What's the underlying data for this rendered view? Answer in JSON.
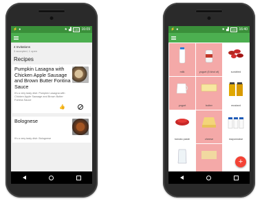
{
  "status": {
    "left_time": "16:09",
    "right_time": "16:40",
    "battery": "100"
  },
  "left_app": {
    "invitations_title": "4 Invitations",
    "invitations_sub": "3 accepted, 1 open",
    "section_title": "Recipes",
    "cards": [
      {
        "title": "Pumpkin Lasagna with Chicken Apple Sausage and Brown Butter Fontina Sauce",
        "desc": "It's a very tasty dish: Pumpkin Lasagna with Chicken Apple Sausage and Brown Butter Fontina Sauce"
      },
      {
        "title": "Bolognese",
        "desc": "It's a very tasty dish: Bolognese"
      }
    ]
  },
  "right_app": {
    "tiles": [
      {
        "label": "milk"
      },
      {
        "label": "yogurt (5 kind of)"
      },
      {
        "label": "sundried"
      },
      {
        "label": "yogurt"
      },
      {
        "label": "butter"
      },
      {
        "label": "mustard"
      },
      {
        "label": "tomato paste"
      },
      {
        "label": "cheese"
      },
      {
        "label": "mayonnaise"
      },
      {
        "label": ""
      },
      {
        "label": ""
      }
    ],
    "fab_label": "+"
  },
  "colors": {
    "statusbar": "#3a8f3a",
    "appbar": "#4caf50",
    "tile_highlight": "#f4a9a8",
    "fab": "#f44336"
  }
}
